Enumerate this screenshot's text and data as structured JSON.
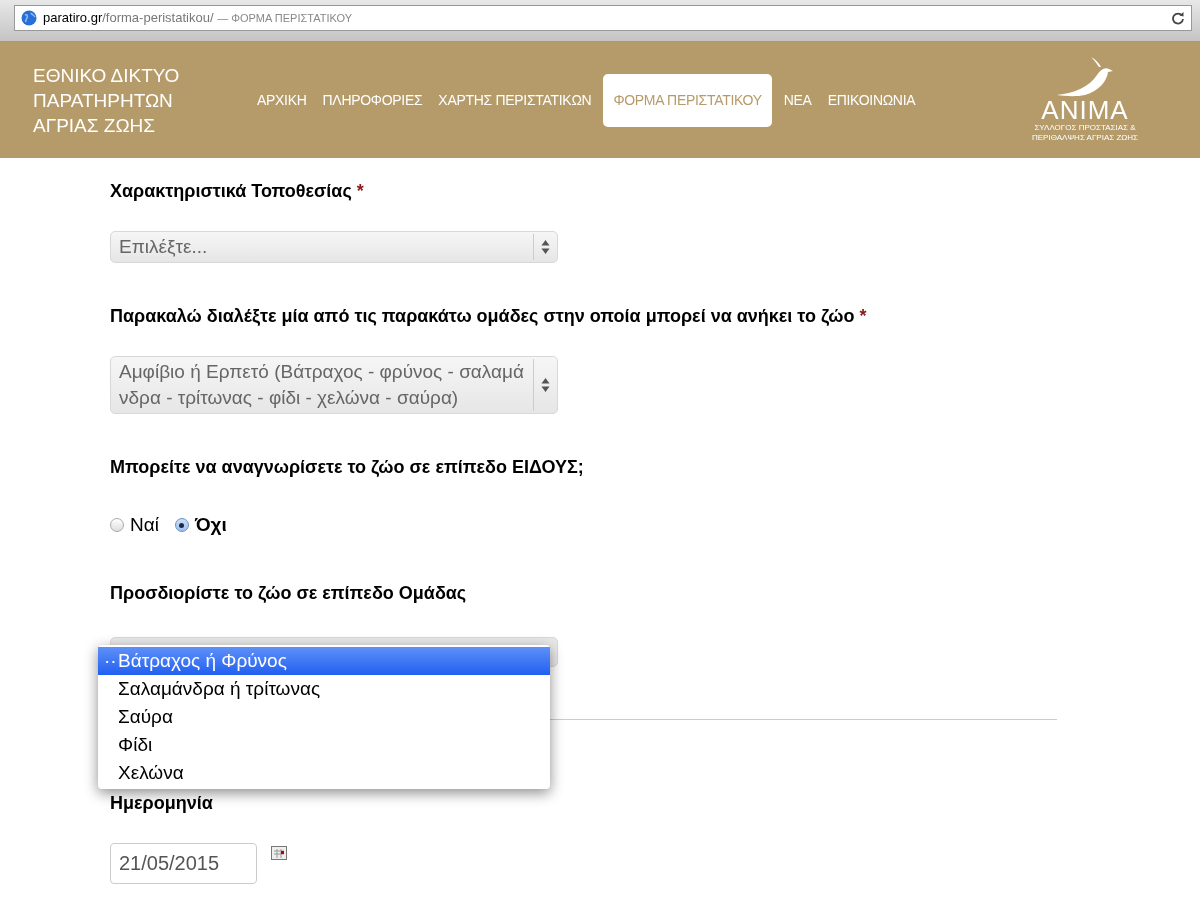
{
  "browser": {
    "url_domain": "paratiro.gr",
    "url_path": "/forma-peristatikou/",
    "page_title": "— ΦΟΡΜΑ ΠΕΡΙΣΤΑΤΙΚΟΥ"
  },
  "header": {
    "site_title_lines": [
      "ΕΘΝΙΚΟ ΔΙΚΤΥΟ",
      "ΠΑΡΑΤΗΡΗΤΩΝ",
      "ΑΓΡΙΑΣ ΖΩΗΣ"
    ],
    "nav": [
      {
        "label": "ΑΡΧΙΚΗ",
        "selected": false
      },
      {
        "label": "ΠΛΗΡΟΦΟΡΙΕΣ",
        "selected": false
      },
      {
        "label": "ΧΑΡΤΗΣ ΠΕΡΙΣΤΑΤΙΚΩΝ",
        "selected": false
      },
      {
        "label": "ΦΟΡΜΑ ΠΕΡΙΣΤΑΤΙΚΟΥ",
        "selected": true
      },
      {
        "label": "ΝΕΑ",
        "selected": false
      },
      {
        "label": "ΕΠΙΚΟΙΝΩΝΙΑ",
        "selected": false
      }
    ],
    "logo": {
      "name": "ANIMA",
      "subtitle_lines": [
        "ΣΥΛΛΟΓΟΣ ΠΡΟΣΤΑΣΙΑΣ &",
        "ΠΕΡΙΘΑΛΨΗΣ ΑΓΡΙΑΣ ΖΩΗΣ"
      ]
    }
  },
  "fields": [
    {
      "kind": "select",
      "label": "Χαρακτηριστικά Τοποθεσίας",
      "required_mark": "*",
      "value": "Επιλέξτε..."
    },
    {
      "kind": "select",
      "label": "Παρακαλώ διαλέξτε μία από τις παρακάτω ομάδες στην οποία μπορεί να ανήκει το ζώο",
      "required_mark": "*",
      "value": "Αμφίβιο ή Ερπετό (Βάτραχος - φρύνος - σαλαμάνδρα - τρίτωνας - φίδι - χελώνα - σαύρα)"
    },
    {
      "kind": "radio",
      "label": "Μπορείτε να αναγνωρίσετε το ζώο σε επίπεδο ΕΙΔΟΥΣ;",
      "options": [
        {
          "label": "Ναί",
          "selected": false
        },
        {
          "label": "Όχι",
          "selected": true
        }
      ]
    },
    {
      "kind": "dropdown",
      "label": "Προσδιορίστε το ζώο σε επίπεδο Ομάδας",
      "options": [
        {
          "label": "Βάτραχος ή Φρύνος",
          "mark": "··",
          "selected": true
        },
        {
          "label": "Σαλαμάνδρα ή τρίτωνας",
          "selected": false
        },
        {
          "label": "Σαύρα",
          "selected": false
        },
        {
          "label": "Φίδι",
          "selected": false
        },
        {
          "label": "Χελώνα",
          "selected": false
        }
      ]
    },
    {
      "kind": "divider"
    },
    {
      "kind": "date",
      "label": "Ημερομηνία",
      "value": "21/05/2015"
    }
  ]
}
